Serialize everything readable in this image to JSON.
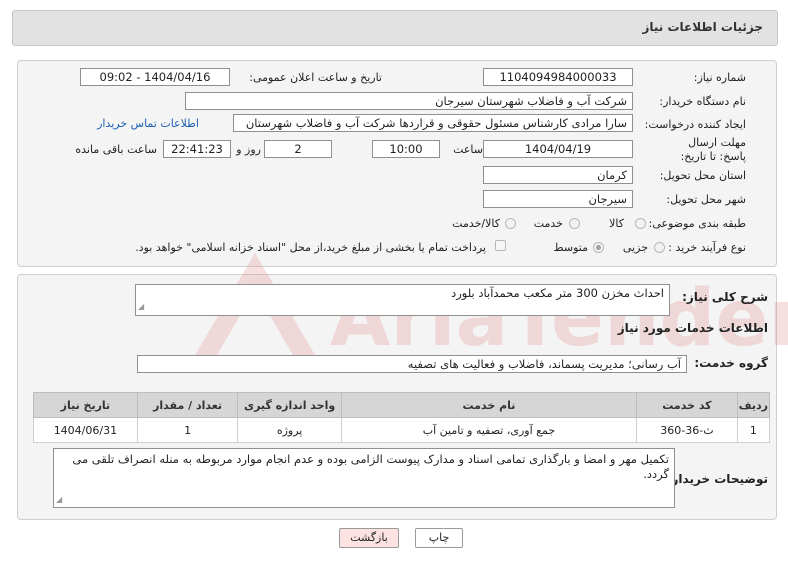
{
  "header": {
    "title": "جزئیات اطلاعات نیاز"
  },
  "form": {
    "need_number_label": "شماره نیاز:",
    "need_number": "1104094984000033",
    "announce_label": "تاریخ و ساعت اعلان عمومی:",
    "announce_value": "1404/04/16 - 09:02",
    "buyer_label": "نام دستگاه خریدار:",
    "buyer_value": "شرکت آب و فاضلاب شهرستان سیرجان",
    "creator_label": "ایجاد کننده درخواست:",
    "creator_value": "سارا مرادی کارشناس مسئول حقوقی و قراردها شرکت آب و فاضلاب شهرستان",
    "contact_link": "اطلاعات تماس خریدار",
    "deadline_label": "مهلت ارسال پاسخ: تا تاریخ:",
    "deadline_date": "1404/04/19",
    "time_label": "ساعت",
    "deadline_time": "10:00",
    "days_value": "2",
    "days_label": "روز و",
    "remaining_time": "22:41:23",
    "remaining_label": "ساعت باقی مانده",
    "province_label": "استان محل تحویل:",
    "province_value": "کرمان",
    "city_label": "شهر محل تحویل:",
    "city_value": "سیرجان",
    "category_label": "طبقه بندی موضوعی:",
    "category_options": [
      "کالا",
      "خدمت",
      "کالا/خدمت"
    ],
    "process_label": "نوع فرآیند خرید :",
    "process_options": [
      "جزیی",
      "متوسط"
    ],
    "payment_note": "پرداخت تمام یا بخشی از مبلغ خرید،از محل \"اسناد خزانه اسلامی\" خواهد بود."
  },
  "summary": {
    "label": "شرح کلی نیاز:",
    "value": "احداث مخزن 300 متر مکعب محمدآباد بلورد"
  },
  "services": {
    "section_title": "اطلاعات خدمات مورد نیاز",
    "group_label": "گروه خدمت:",
    "group_value": "آب رسانی؛ مدیریت پسماند، فاضلاب و فعالیت های تصفیه",
    "columns": [
      "ردیف",
      "کد خدمت",
      "نام خدمت",
      "واحد اندازه گیری",
      "تعداد / مقدار",
      "تاریخ نیاز"
    ],
    "rows": [
      [
        "1",
        "ث-36-360",
        "جمع آوری، تصفیه و تامین آب",
        "پروژه",
        "1",
        "1404/06/31"
      ]
    ]
  },
  "notes": {
    "label": "توضیحات خریدار:",
    "value": "تکمیل مهر و امضا و بارگذاری تمامی اسناد و مدارک پیوست الزامی بوده و عدم انجام موارد مربوطه به منله انصراف تلقی می گردد."
  },
  "buttons": {
    "print": "چاپ",
    "back": "بازگشت"
  },
  "watermark": {
    "text": "AriaTender.net"
  },
  "colors": {
    "link": "#1a5fb4",
    "back_button": "#fde2e2",
    "watermark": "#e38f8f"
  }
}
